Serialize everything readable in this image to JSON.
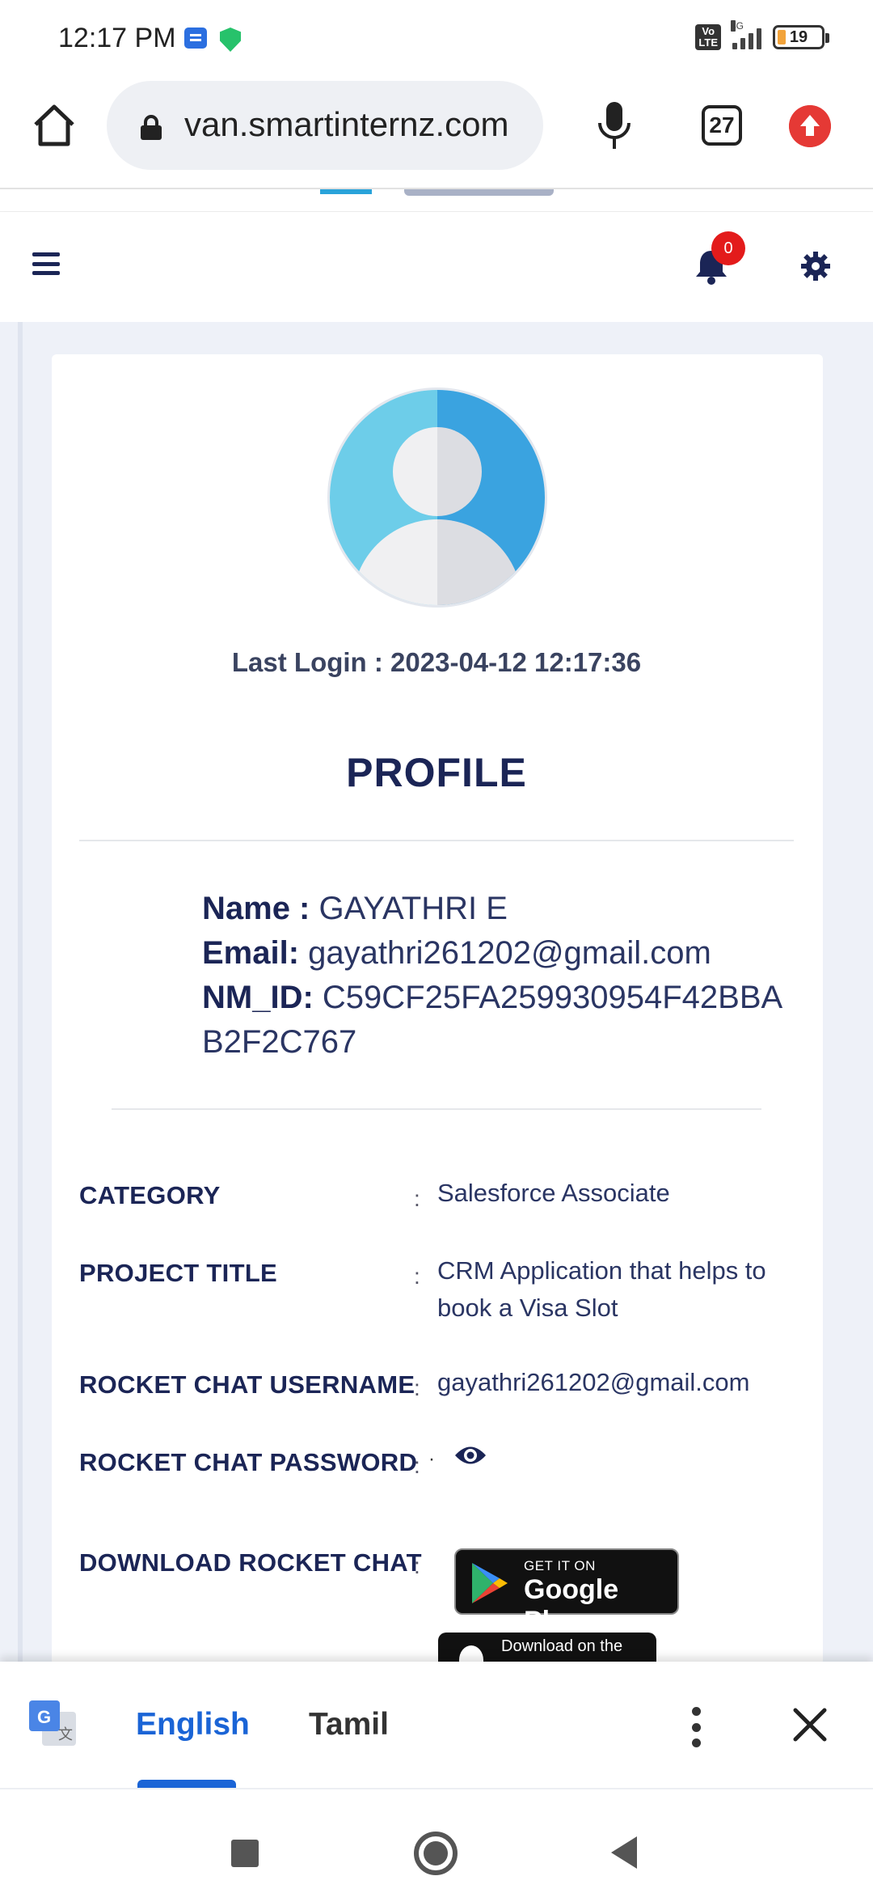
{
  "status_bar": {
    "time": "12:17 PM",
    "network": "4G",
    "volte": "Vo LTE",
    "battery": "19"
  },
  "browser": {
    "url": "van.smartinternz.com",
    "tab_count": "27"
  },
  "nav": {
    "notification_count": "0"
  },
  "profile": {
    "last_login_label": "Last Login : 2023-04-12 12:17:36",
    "title": "PROFILE",
    "name_label": "Name :",
    "name_value": "GAYATHRI E",
    "email_label": "Email:",
    "email_value": "gayathri261202@gmail.com",
    "nmid_label": "NM_ID:",
    "nmid_value": "C59CF25FA259930954F42BBAB2F2C767"
  },
  "details": [
    {
      "label": "CATEGORY",
      "value": "Salesforce Associate"
    },
    {
      "label": "PROJECT TITLE",
      "value": "CRM Application that helps to book a Visa Slot"
    },
    {
      "label": "ROCKET CHAT USERNAME",
      "value": "gayathri261202@gmail.com"
    },
    {
      "label": "ROCKET CHAT PASSWORD",
      "value": "·"
    },
    {
      "label": "DOWNLOAD ROCKET CHAT",
      "value": ""
    }
  ],
  "badges": {
    "gplay_small": "GET IT ON",
    "gplay_big": "Google Play",
    "appstore_small": "Download on the"
  },
  "translate": {
    "lang_primary": "English",
    "lang_secondary": "Tamil"
  },
  "icons": {
    "home": "home-icon",
    "lock": "lock-icon",
    "mic": "mic-icon",
    "tabs": "tabs-icon",
    "update": "update-arrow-icon",
    "menu": "hamburger-icon",
    "bell": "bell-icon",
    "gear": "gear-icon",
    "eye": "eye-icon",
    "translate": "google-translate-icon",
    "more": "more-vert-icon",
    "close": "close-icon"
  },
  "colors": {
    "primary_navy": "#1b2556",
    "accent_blue": "#1a64d6",
    "badge_red": "#e31b1b",
    "page_bg": "#eef1f8"
  }
}
